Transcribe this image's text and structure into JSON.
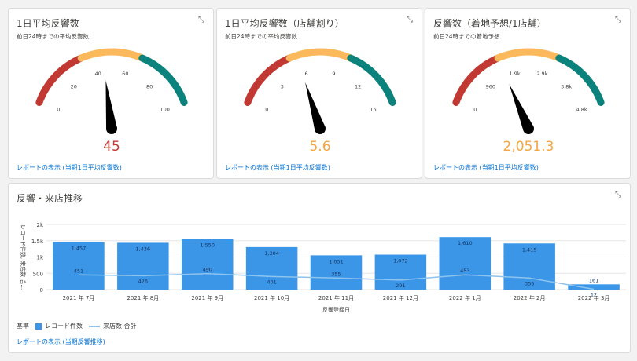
{
  "expand_glyph": "⤡",
  "cards": [
    {
      "title": "1日平均反響数",
      "subtitle": "前日24時までの平均反響数",
      "value": "45",
      "value_color": "#c23934",
      "ticks": [
        "0",
        "20",
        "40",
        "60",
        "80",
        "100"
      ],
      "range": [
        0,
        100
      ],
      "needle_value": 45,
      "link": "レポートの表示 (当期1日平均反響数)"
    },
    {
      "title": "1日平均反響数（店舗割り）",
      "subtitle": "前日24時までの平均反響数",
      "value": "5.6",
      "value_color": "#f5a542",
      "ticks": [
        "0",
        "3",
        "6",
        "9",
        "12",
        "15"
      ],
      "range": [
        0,
        15
      ],
      "needle_value": 5.6,
      "link": "レポートの表示 (当期1日平均反響数)"
    },
    {
      "title": "反響数（着地予想/1店舗）",
      "subtitle": "前日24時までの着地予想",
      "value": "2,051.3",
      "value_color": "#f5a542",
      "ticks": [
        "0",
        "960",
        "1.9k",
        "2.9k",
        "3.8k",
        "4.8k"
      ],
      "range": [
        0,
        4800
      ],
      "needle_value": 1600,
      "link": "レポートの表示 (当期1日平均反響数)"
    }
  ],
  "gauge_colors": {
    "low": "#c23934",
    "mid": "#fcb95b",
    "high": "#04844b",
    "high_alt": "#0b827c",
    "needle": "#000000"
  },
  "bottom": {
    "title": "反響・来店推移",
    "link": "レポートの表示 (当期反響推移)",
    "legend_label": "基準",
    "legend_bar": "レコード件数",
    "legend_line": "来店数 合計"
  },
  "chart_data": {
    "type": "bar",
    "categories": [
      "2021 年 7月",
      "2021 年 8月",
      "2021 年 9月",
      "2021 年 10月",
      "2021 年 11月",
      "2021 年 12月",
      "2022 年 1月",
      "2022 年 2月",
      "2022 年 3月"
    ],
    "series": [
      {
        "name": "レコード件数",
        "type": "bar",
        "color": "#3b96e8",
        "values": [
          1457,
          1436,
          1550,
          1304,
          1051,
          1072,
          1610,
          1415,
          161
        ],
        "labels": [
          "1,457",
          "1,436",
          "1,550",
          "1,304",
          "1,051",
          "1,072",
          "1,610",
          "1,415",
          "161"
        ]
      },
      {
        "name": "来店数 合計",
        "type": "line",
        "color": "#8ec3ec",
        "values": [
          451,
          426,
          490,
          401,
          355,
          291,
          453,
          355,
          12
        ],
        "labels": [
          "451",
          "426",
          "490",
          "401",
          "355",
          "291",
          "453",
          "355",
          "12"
        ]
      }
    ],
    "xlabel": "反響登録日",
    "ylabel": "レコード件数, 来店数 合...",
    "yticks": [
      "0",
      "500",
      "1k",
      "1.5k",
      "2k"
    ],
    "ylim": [
      0,
      2000
    ],
    "grid": true
  }
}
